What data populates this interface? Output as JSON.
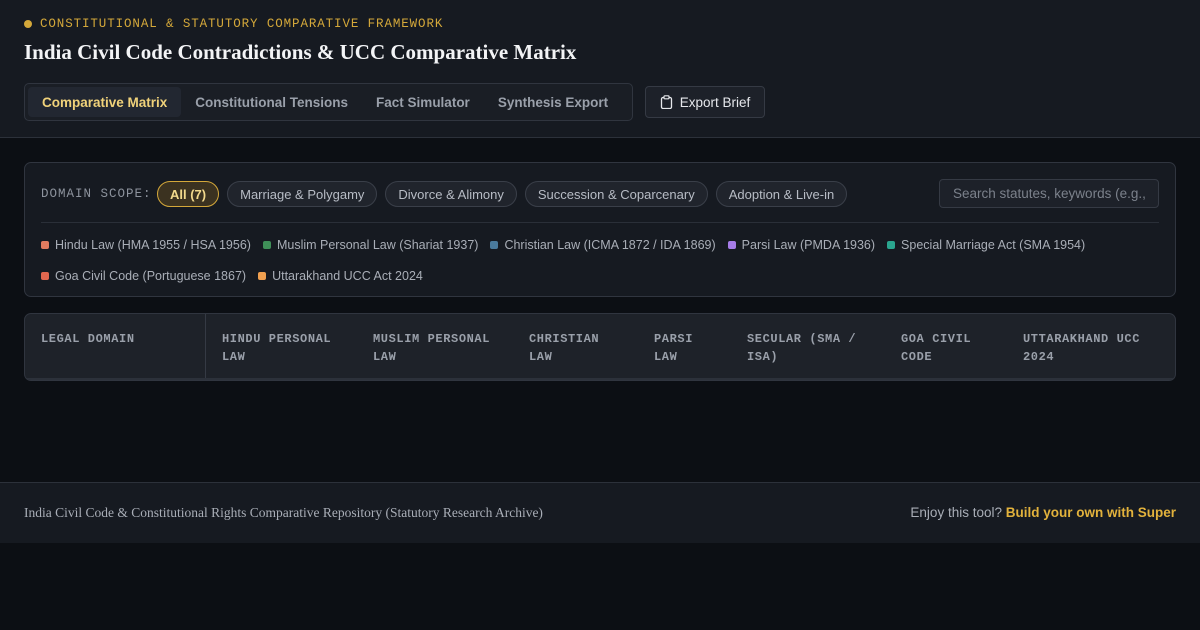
{
  "header": {
    "eyebrow": "CONSTITUTIONAL & STATUTORY COMPARATIVE FRAMEWORK",
    "title": "India Civil Code Contradictions & UCC Comparative Matrix"
  },
  "tabs": [
    {
      "label": "Comparative Matrix",
      "active": true
    },
    {
      "label": "Constitutional Tensions",
      "active": false
    },
    {
      "label": "Fact Simulator",
      "active": false
    },
    {
      "label": "Synthesis Export",
      "active": false
    }
  ],
  "export_button": {
    "label": "Export Brief",
    "icon": "clipboard-icon"
  },
  "filters": {
    "scope_label": "DOMAIN SCOPE:",
    "chips": [
      {
        "label": "All (7)",
        "active": true
      },
      {
        "label": "Marriage & Polygamy",
        "active": false
      },
      {
        "label": "Divorce & Alimony",
        "active": false
      },
      {
        "label": "Succession & Coparcenary",
        "active": false
      },
      {
        "label": "Adoption & Live-in",
        "active": false
      }
    ],
    "search_placeholder": "Search statutes, keywords (e.g., ...",
    "accent_color": "#d4a83a"
  },
  "legend": [
    {
      "label": "Hindu Law (HMA 1955 / HSA 1956)",
      "color": "#e07b5f"
    },
    {
      "label": "Muslim Personal Law (Shariat 1937)",
      "color": "#3f8f58"
    },
    {
      "label": "Christian Law (ICMA 1872 / IDA 1869)",
      "color": "#4a7a9c"
    },
    {
      "label": "Parsi Law (PMDA 1936)",
      "color": "#a67ce8"
    },
    {
      "label": "Special Marriage Act (SMA 1954)",
      "color": "#2aa58f"
    },
    {
      "label": "Goa Civil Code (Portuguese 1867)",
      "color": "#e0674f"
    },
    {
      "label": "Uttarakhand UCC Act 2024",
      "color": "#f0a050"
    }
  ],
  "matrix": {
    "columns": [
      [
        "LEGAL DOMAIN"
      ],
      [
        "HINDU PERSONAL",
        "LAW"
      ],
      [
        "MUSLIM PERSONAL",
        "LAW"
      ],
      [
        "CHRISTIAN",
        "LAW"
      ],
      [
        "PARSI",
        "LAW"
      ],
      [
        "SECULAR (SMA /",
        "ISA)"
      ],
      [
        "GOA CIVIL",
        "CODE"
      ],
      [
        "UTTARAKHAND UCC",
        "2024"
      ]
    ]
  },
  "footer": {
    "left": "India Civil Code & Constitutional Rights Comparative Repository (Statutory Research Archive)",
    "right_prefix": "Enjoy this tool?",
    "right_link": "Build your own with Super"
  }
}
